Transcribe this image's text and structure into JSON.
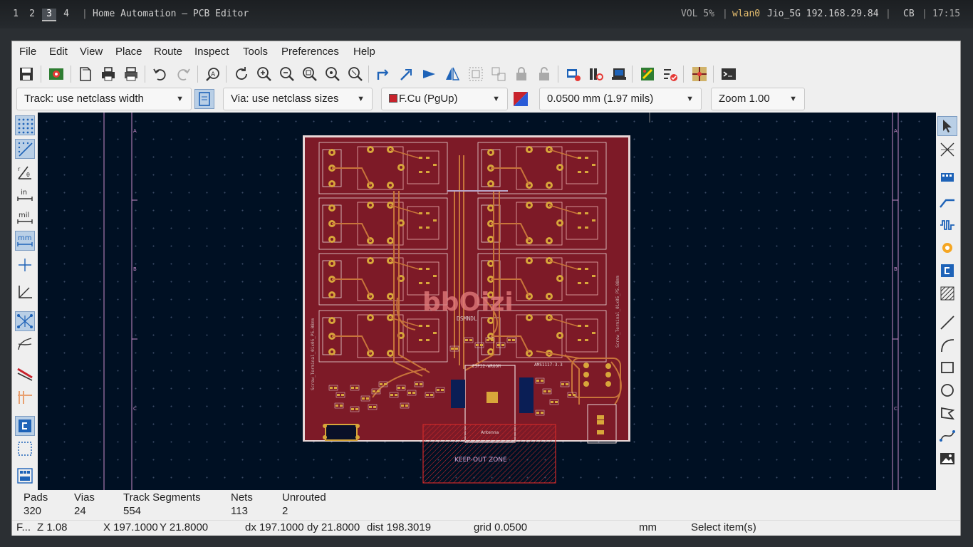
{
  "topbar": {
    "workspaces": [
      "1",
      "2",
      "3",
      "4"
    ],
    "active_workspace": "3",
    "window_title": "Home Automation — PCB Editor",
    "volume": "VOL 5%",
    "network_iface": "wlan0",
    "network_info": "Jio_5G 192.168.29.84",
    "keyboard": "CB",
    "clock": "17:15"
  },
  "menubar": [
    "File",
    "Edit",
    "View",
    "Place",
    "Route",
    "Inspect",
    "Tools",
    "Preferences",
    "Help"
  ],
  "toolbar2": {
    "track_width": "Track: use netclass width",
    "via_size": "Via: use netclass sizes",
    "layer": "F.Cu (PgUp)",
    "grid": "0.0500 mm (1.97 mils)",
    "zoom": "Zoom 1.00"
  },
  "board": {
    "keepout_label": "KEEP-OUT ZONE",
    "antenna_label": "Antenna",
    "module_label": "ESP32-WROOM",
    "regulator_label": "AMS1117-3.3",
    "logo_text": "bbOizi",
    "border_letters": [
      "A",
      "B",
      "C"
    ]
  },
  "messages": {
    "headers": [
      "Pads",
      "Vias",
      "Track Segments",
      "Nets",
      "Unrouted"
    ],
    "values": [
      "320",
      "24",
      "554",
      "113",
      "2"
    ]
  },
  "statusbar": {
    "file": "F...",
    "zoom": "Z 1.08",
    "x": "X 197.1000",
    "y": "Y 21.8000",
    "dx": "dx 197.1000",
    "dy": "dy 21.8000",
    "dist": "dist 198.3019",
    "grid": "grid 0.0500",
    "units": "mm",
    "mode": "Select item(s)"
  },
  "colors": {
    "board_fill": "#7d1a27",
    "copper": "#c8743a",
    "pad": "#d8a63a",
    "canvas_bg": "#001023"
  }
}
